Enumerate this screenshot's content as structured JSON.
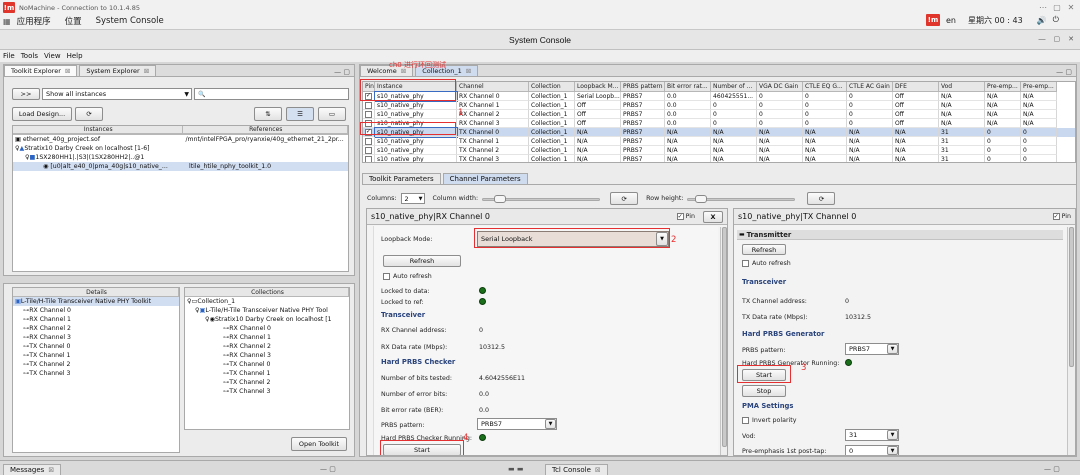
{
  "os": {
    "app_title": "NoMachine - Connection to 10.1.4.85",
    "menu": [
      "应用程序",
      "位置",
      "System Console"
    ],
    "lang": "en",
    "clock": "星期六 00 : 43"
  },
  "app": {
    "title": "System Console",
    "menu": [
      "File",
      "Tools",
      "View",
      "Help"
    ]
  },
  "left": {
    "tabs": [
      "Toolkit Explorer",
      "System Explorer"
    ],
    "filter": ">>",
    "show_all": "Show all instances",
    "search_placeholder": "",
    "load_design": "Load Design...",
    "col_instances": "Instances",
    "col_references": "References",
    "tree": [
      {
        "label": "ethernet_40g_project.sof",
        "ref": "/mnt/intelFPGA_pro/ryanxie/40g_ethernet_21_2pr..."
      },
      {
        "label": "Stratix10 Darby Creek on localhost [1-6]",
        "ref": ""
      },
      {
        "label": "1SX280HH1|.|S3|(1SX280HH2|..@1",
        "ref": ""
      },
      {
        "label": "[u0|alt_e40_0|pma_40g|s10_native_...",
        "ref": "ltile_htile_nphy_toolkit_1.0"
      }
    ],
    "details_header": "Details",
    "details_title": "L-Tile/H-Tile Transceiver Native PHY Toolkit",
    "details_items": [
      "RX Channel 0",
      "RX Channel 1",
      "RX Channel 2",
      "RX Channel 3",
      "TX Channel 0",
      "TX Channel 1",
      "TX Channel 2",
      "TX Channel 3"
    ],
    "collections_header": "Collections",
    "collections_root": "Collection_1",
    "collections_toolkit": "L-Tile/H-Tile Transceiver Native PHY Tool",
    "collections_device": "Stratix10 Darby Creek on localhost [1",
    "collections_items": [
      "RX Channel 0",
      "RX Channel 1",
      "RX Channel 2",
      "RX Channel 3",
      "TX Channel 0",
      "TX Channel 1",
      "TX Channel 2",
      "TX Channel 3"
    ],
    "open_toolkit": "Open Toolkit"
  },
  "right": {
    "tabs": [
      "Welcome",
      "Collection_1"
    ],
    "annotation": "ch0 进行环回测试",
    "table_headers": [
      "Pin",
      "Instance",
      "Channel",
      "Collection",
      "Loopback M...",
      "PRBS pattern",
      "Bit error rat...",
      "Number of ...",
      "VGA DC Gain",
      "CTLE EQ G...",
      "CTLE AC Gain",
      "DFE",
      "Vod",
      "Pre-emp...",
      "Pre-emp..."
    ],
    "rows": [
      {
        "pin": true,
        "inst": "s10_native_phy",
        "ch": "RX Channel 0",
        "coll": "Collection_1",
        "lb": "Serial Loopb...",
        "prbs": "PRBS7",
        "ber": "0.0",
        "num": "460425551...",
        "vga": "0",
        "ctleq": "0",
        "ctleac": "0",
        "dfe": "Off",
        "vod": "N/A",
        "pe1": "N/A",
        "pe2": "N/A",
        "sel": false
      },
      {
        "pin": false,
        "inst": "s10_native_phy",
        "ch": "RX Channel 1",
        "coll": "Collection_1",
        "lb": "Off",
        "prbs": "PRBS7",
        "ber": "0.0",
        "num": "0",
        "vga": "0",
        "ctleq": "0",
        "ctleac": "0",
        "dfe": "Off",
        "vod": "N/A",
        "pe1": "N/A",
        "pe2": "N/A",
        "sel": false
      },
      {
        "pin": false,
        "inst": "s10_native_phy",
        "ch": "RX Channel 2",
        "coll": "Collection_1",
        "lb": "Off",
        "prbs": "PRBS7",
        "ber": "0.0",
        "num": "0",
        "vga": "0",
        "ctleq": "0",
        "ctleac": "0",
        "dfe": "Off",
        "vod": "N/A",
        "pe1": "N/A",
        "pe2": "N/A",
        "sel": false
      },
      {
        "pin": false,
        "inst": "s10_native_phy",
        "ch": "RX Channel 3",
        "coll": "Collection_1",
        "lb": "Off",
        "prbs": "PRBS7",
        "ber": "0.0",
        "num": "0",
        "vga": "0",
        "ctleq": "0",
        "ctleac": "0",
        "dfe": "Off",
        "vod": "N/A",
        "pe1": "N/A",
        "pe2": "N/A",
        "sel": false
      },
      {
        "pin": true,
        "inst": "s10_native_phy",
        "ch": "TX Channel 0",
        "coll": "Collection_1",
        "lb": "N/A",
        "prbs": "PRBS7",
        "ber": "N/A",
        "num": "N/A",
        "vga": "N/A",
        "ctleq": "N/A",
        "ctleac": "N/A",
        "dfe": "N/A",
        "vod": "31",
        "pe1": "0",
        "pe2": "0",
        "sel": true
      },
      {
        "pin": false,
        "inst": "s10_native_phy",
        "ch": "TX Channel 1",
        "coll": "Collection_1",
        "lb": "N/A",
        "prbs": "PRBS7",
        "ber": "N/A",
        "num": "N/A",
        "vga": "N/A",
        "ctleq": "N/A",
        "ctleac": "N/A",
        "dfe": "N/A",
        "vod": "31",
        "pe1": "0",
        "pe2": "0",
        "sel": false
      },
      {
        "pin": false,
        "inst": "s10_native_phy",
        "ch": "TX Channel 2",
        "coll": "Collection_1",
        "lb": "N/A",
        "prbs": "PRBS7",
        "ber": "N/A",
        "num": "N/A",
        "vga": "N/A",
        "ctleq": "N/A",
        "ctleac": "N/A",
        "dfe": "N/A",
        "vod": "31",
        "pe1": "0",
        "pe2": "0",
        "sel": false
      },
      {
        "pin": false,
        "inst": "s10_native_phy",
        "ch": "TX Channel 3",
        "coll": "Collection_1",
        "lb": "N/A",
        "prbs": "PRBS7",
        "ber": "N/A",
        "num": "N/A",
        "vga": "N/A",
        "ctleq": "N/A",
        "ctleac": "N/A",
        "dfe": "N/A",
        "vod": "31",
        "pe1": "0",
        "pe2": "0",
        "sel": false
      }
    ],
    "param_tabs": [
      "Toolkit Parameters",
      "Channel Parameters"
    ],
    "columns_label": "Columns:",
    "columns_value": "2",
    "column_width_label": "Column width:",
    "row_height_label": "Row height:",
    "rx": {
      "title": "s10_native_phy|RX Channel 0",
      "pin_label": "Pin",
      "close": "X",
      "loopback_label": "Loopback Mode:",
      "loopback_value": "Serial Loopback",
      "refresh": "Refresh",
      "auto_refresh": "Auto refresh",
      "locked_data": "Locked to data:",
      "locked_ref": "Locked to ref:",
      "transceiver": "Transceiver",
      "rx_addr_label": "RX Channel address:",
      "rx_addr_value": "0",
      "rx_rate_label": "RX Data rate (Mbps):",
      "rx_rate_value": "10312.5",
      "checker": "Hard PRBS Checker",
      "bits_tested_label": "Number of bits tested:",
      "bits_tested_value": "4.6042556E11",
      "errors_label": "Number of error bits:",
      "errors_value": "0.0",
      "ber_label": "Bit error rate (BER):",
      "ber_value": "0.0",
      "prbs_label": "PRBS pattern:",
      "prbs_value": "PRBS7",
      "running_label": "Hard PRBS Checker Running:",
      "start": "Start"
    },
    "tx": {
      "title": "s10_native_phy|TX Channel 0",
      "pin_label": "Pin",
      "transmitter": "Transmitter",
      "refresh": "Refresh",
      "auto_refresh": "Auto refresh",
      "transceiver": "Transceiver",
      "tx_addr_label": "TX Channel address:",
      "tx_addr_value": "0",
      "tx_rate_label": "TX Data rate (Mbps):",
      "tx_rate_value": "10312.5",
      "generator": "Hard PRBS Generator",
      "prbs_label": "PRBS pattern:",
      "prbs_value": "PRBS7",
      "running_label": "Hard PRBS Generator Running:",
      "start": "Start",
      "stop": "Stop",
      "pma": "PMA Settings",
      "invert": "Invert polarity",
      "vod_label": "Vod:",
      "vod_value": "31",
      "pe_label": "Pre-emphasis 1st post-tap:",
      "pe_value": "0"
    },
    "markers": [
      "1",
      "2",
      "3",
      "4"
    ]
  },
  "bottom": {
    "messages": "Messages",
    "tcl": "Tcl Console"
  }
}
